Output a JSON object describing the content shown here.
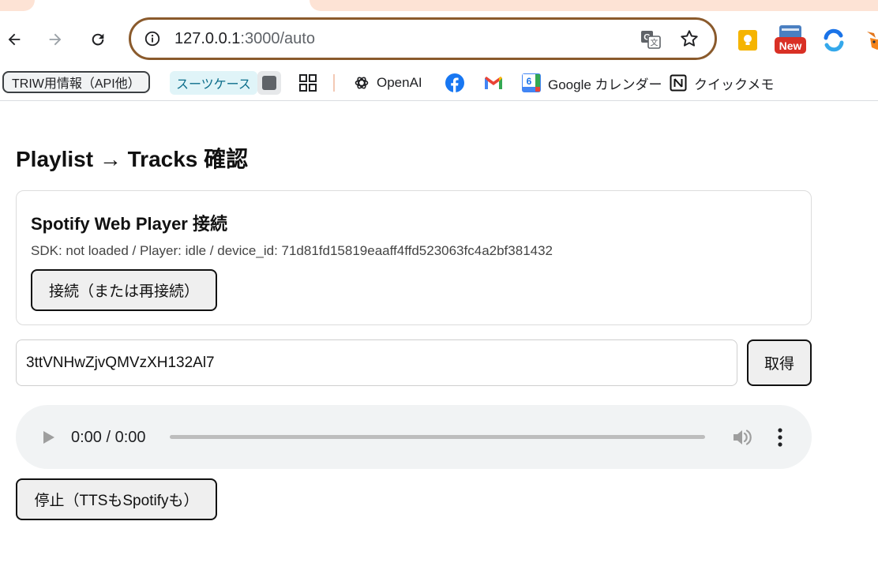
{
  "browser": {
    "url_host": "127.0.0.1",
    "url_path": ":3000/auto",
    "extensions": [
      {
        "name": "keep",
        "color": "#f5b400"
      },
      {
        "name": "new-badge",
        "label": "New",
        "color": "#d93025"
      },
      {
        "name": "sync",
        "color": "#1a73e8"
      },
      {
        "name": "metamask",
        "color": "#e2761b"
      }
    ]
  },
  "bookmarks": {
    "folder_label": "TRIW用情報（API他）",
    "chip_label": "スーツケース",
    "openai_label": "OpenAI",
    "gcal_label": "Google カレンダー",
    "gcal_day": "6",
    "quickmemo_label": "クイックメモ"
  },
  "page": {
    "title": "Playlist → Tracks 確認",
    "player_card": {
      "title": "Spotify Web Player 接続",
      "status": "SDK: not loaded / Player: idle / device_id: 71d81fd15819eaaff4ffd523063fc4a2bf381432",
      "connect_label": "接続（または再接続）"
    },
    "playlist_input_value": "3ttVNHwZjvQMVzXH132Al7",
    "fetch_label": "取得",
    "audio": {
      "time": "0:00 / 0:00",
      "progress": 0
    },
    "stop_label": "停止（TTSもSpotifyも）"
  }
}
